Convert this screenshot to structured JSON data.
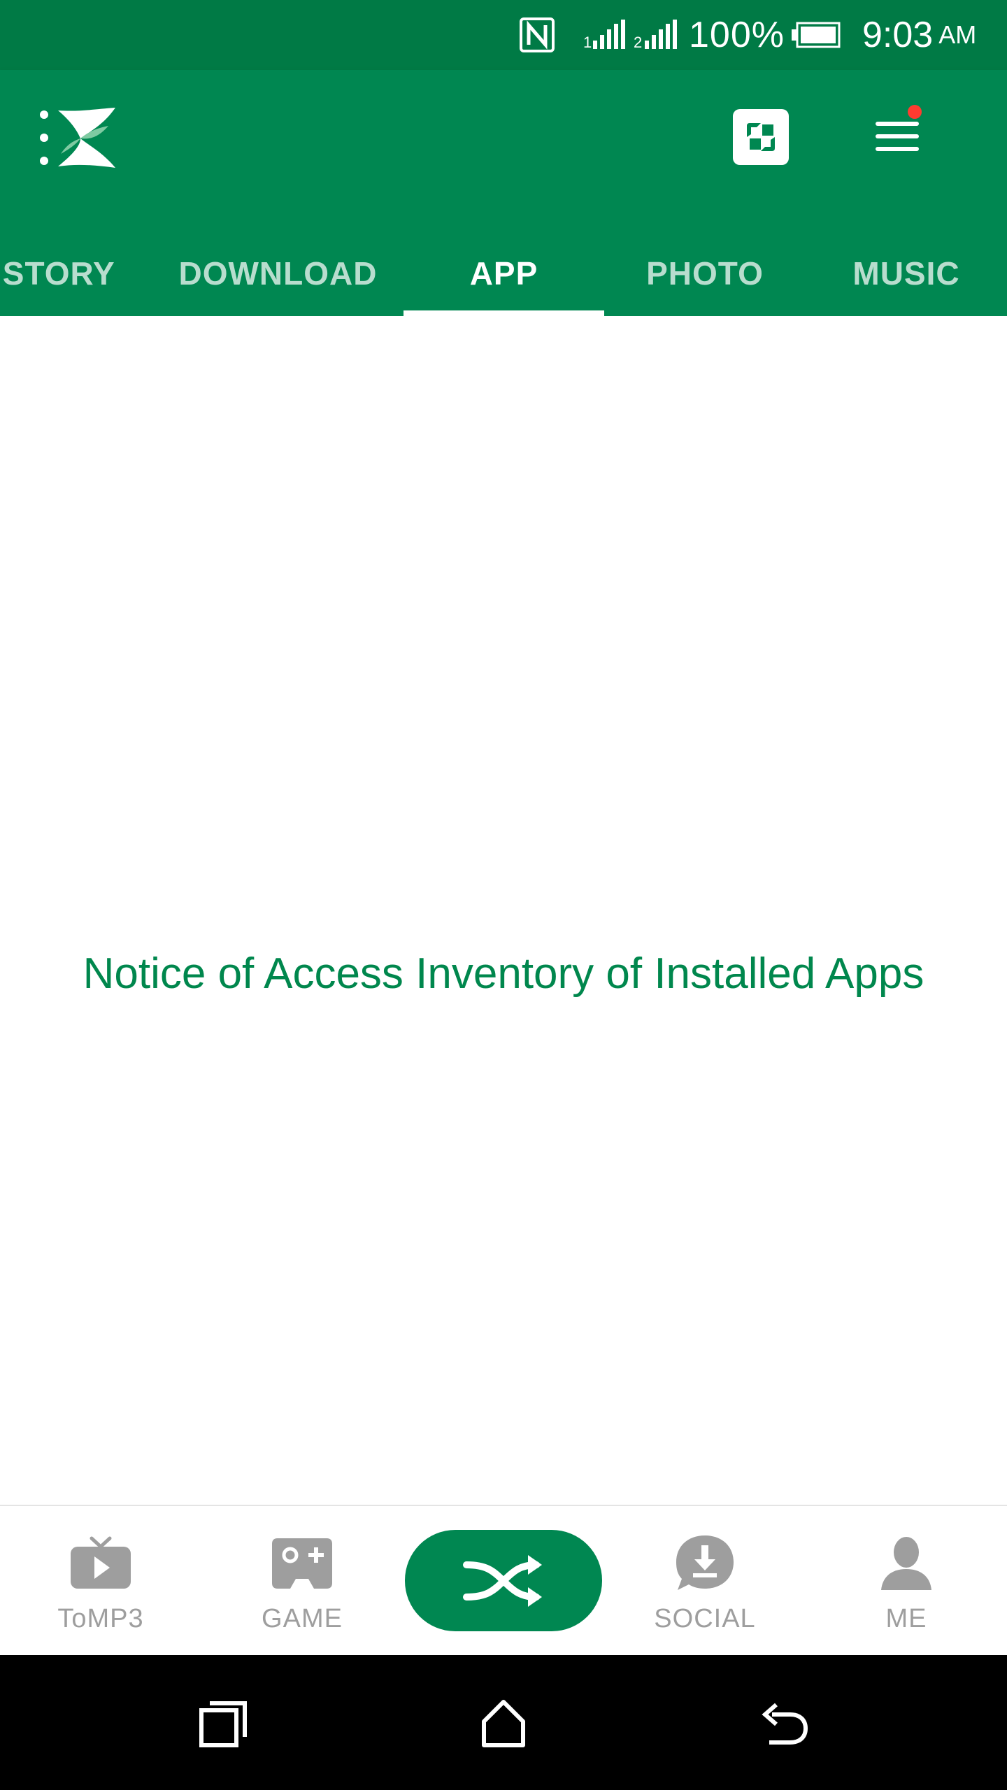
{
  "status_bar": {
    "battery_percent": "100%",
    "time": "9:03",
    "ampm": "AM",
    "icons": [
      "nfc-icon",
      "signal-sim1-icon",
      "signal-sim2-icon",
      "battery-icon"
    ]
  },
  "app_bar": {
    "logo_icon": "xender-logo-icon",
    "transfer_icon": "transfer-icon",
    "menu_icon": "hamburger-menu-icon",
    "has_notification": true
  },
  "tabs": [
    {
      "label": "ISTORY"
    },
    {
      "label": "DOWNLOAD"
    },
    {
      "label": "APP"
    },
    {
      "label": "PHOTO"
    },
    {
      "label": "MUSIC"
    }
  ],
  "active_tab": "APP",
  "main": {
    "notice_link": "Notice of Access Inventory of Installed Apps"
  },
  "bottom_nav": {
    "items": [
      {
        "label": "ToMP3",
        "icon": "tv-play-icon"
      },
      {
        "label": "GAME",
        "icon": "gamepad-icon"
      },
      {
        "label": "SOCIAL",
        "icon": "social-download-icon"
      },
      {
        "label": "ME",
        "icon": "person-icon"
      }
    ],
    "center_icon": "shuffle-icon"
  },
  "system_bar": {
    "icons": [
      "recents-icon",
      "home-icon",
      "back-icon"
    ]
  },
  "colors": {
    "status_bar": "#007a45",
    "app_bar": "#008751",
    "link": "#00874d",
    "nav_inactive": "#9e9e9e",
    "notification_dot": "#ff3b30"
  }
}
